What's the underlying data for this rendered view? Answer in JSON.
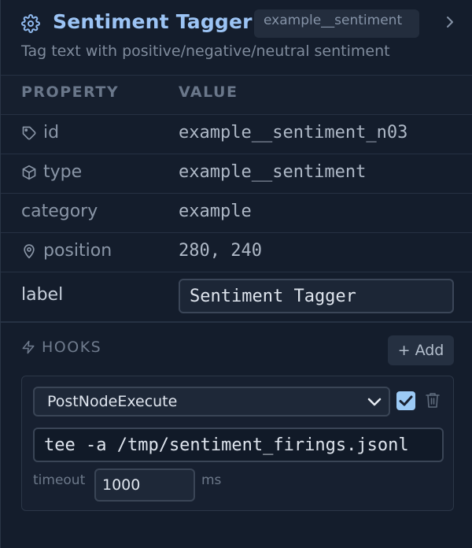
{
  "header": {
    "title": "Sentiment Tagger",
    "type_badge": "example__sentiment",
    "description": "Tag text with positive/negative/neutral sentiment"
  },
  "table": {
    "col_property": "PROPERTY",
    "col_value": "VALUE",
    "rows": [
      {
        "key": "id",
        "value": "example__sentiment_n03",
        "icon": "tag-icon"
      },
      {
        "key": "type",
        "value": "example__sentiment",
        "icon": "cube-icon"
      },
      {
        "key": "category",
        "value": "example",
        "icon": ""
      },
      {
        "key": "position",
        "value": "280, 240",
        "icon": "location-pin-icon"
      }
    ],
    "label_key": "label",
    "label_value": "Sentiment Tagger"
  },
  "hooks": {
    "title": "HOOKS",
    "add_label": "+ Add",
    "items": [
      {
        "event": "PostNodeExecute",
        "enabled": true,
        "command": "tee -a /tmp/sentiment_firings.jsonl",
        "timeout_label": "timeout",
        "timeout_value": "1000",
        "unit": "ms"
      }
    ]
  },
  "colors": {
    "accent": "#9cc4f5",
    "background": "#141d2c",
    "checkbox": "#9ccaf5"
  }
}
